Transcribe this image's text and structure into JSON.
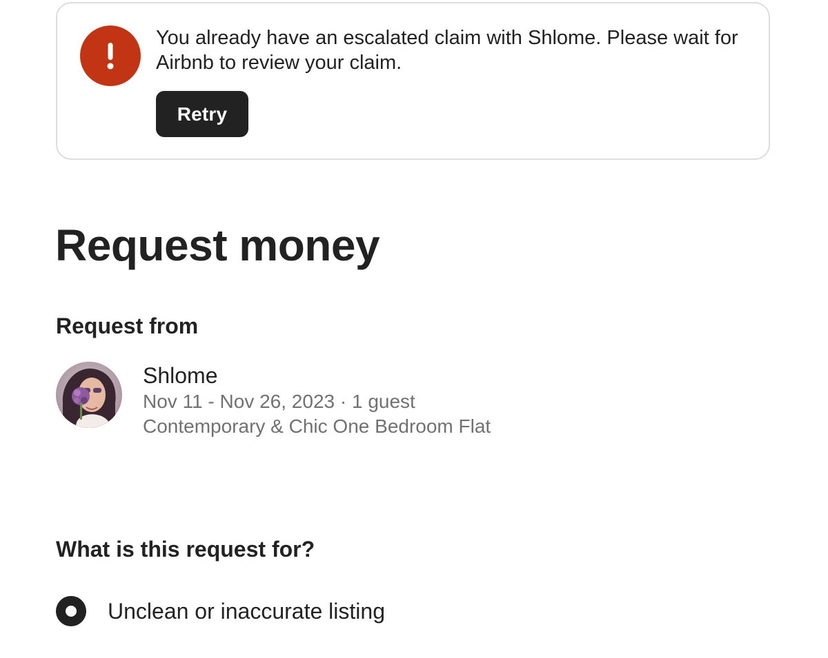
{
  "alert": {
    "icon": "exclamation-icon",
    "icon_color": "#c13515",
    "message": "You already have an escalated claim with Shlome. Please wait for Airbnb to review your claim.",
    "retry_label": "Retry"
  },
  "page": {
    "title": "Request money"
  },
  "request_from": {
    "label": "Request from",
    "guest": {
      "avatar": "guest-avatar-photo",
      "name": "Shlome",
      "dates": "Nov 11 - Nov 26, 2023 · 1 guest",
      "listing": "Contemporary & Chic One Bedroom Flat"
    }
  },
  "request_purpose": {
    "label": "What is this request for?",
    "options": [
      {
        "label": "Unclean or inaccurate listing",
        "selected": true
      }
    ]
  },
  "colors": {
    "text_primary": "#222222",
    "text_secondary": "#717171",
    "error": "#c13515",
    "button_bg": "#222222",
    "border": "#dddddd"
  }
}
